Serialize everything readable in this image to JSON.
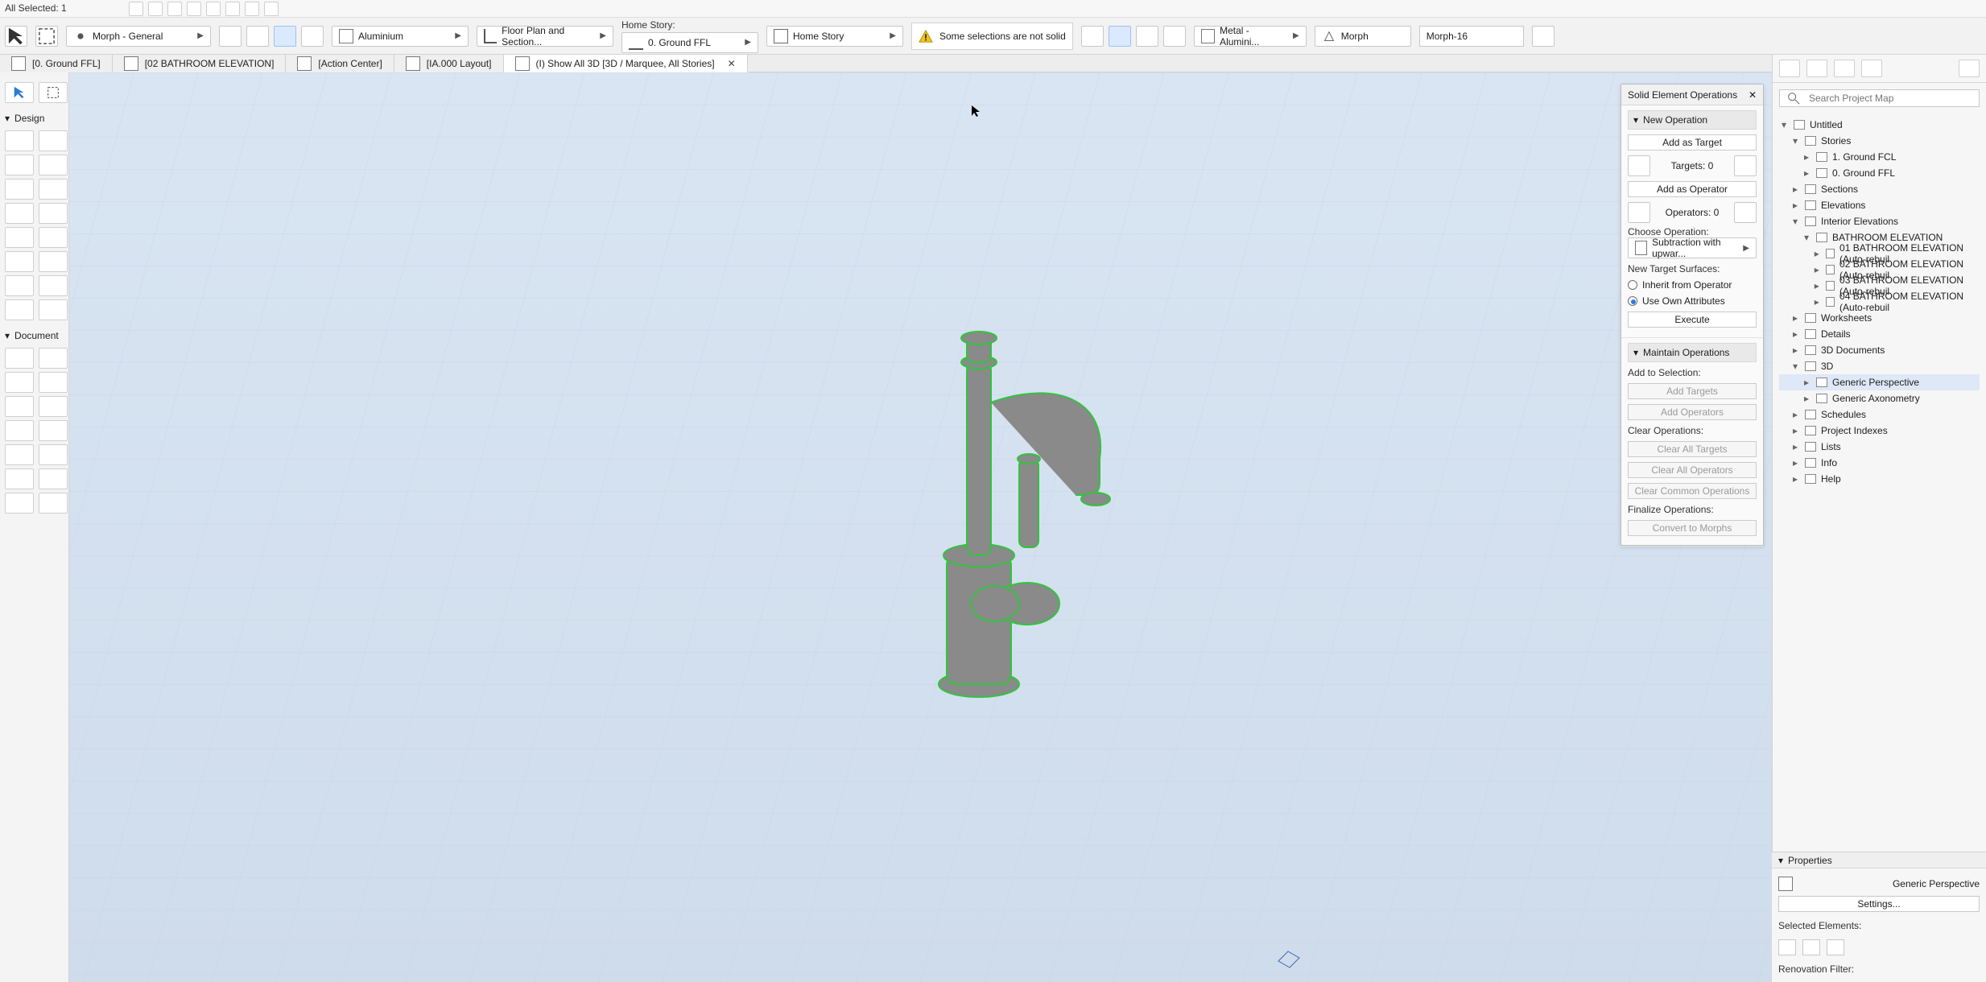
{
  "topbar": {
    "selection_info": "All Selected: 1"
  },
  "info_bar": {
    "layer_combo_label": "Morph - General",
    "material_label": "Aluminium",
    "view_combo_label": "Floor Plan and Section...",
    "home_story_label": "Home Story:",
    "home_story_value": "0. Ground FFL",
    "home_story_right": "Home Story",
    "warning_text": "Some selections are not solid",
    "surface_label": "Metal - Alumini...",
    "morph_label": "Morph",
    "id_value": "Morph-16"
  },
  "tabs": [
    {
      "label": "[0. Ground FFL]"
    },
    {
      "label": "[02 BATHROOM ELEVATION]"
    },
    {
      "label": "[Action Center]"
    },
    {
      "label": "[IA.000 Layout]"
    },
    {
      "label": "(I) Show All 3D [3D / Marquee, All Stories]"
    }
  ],
  "toolbox": {
    "design_label": "Design",
    "document_label": "Document"
  },
  "solid_ops": {
    "title": "Solid Element Operations",
    "new_operation": "New Operation",
    "add_target": "Add as Target",
    "targets_label": "Targets: 0",
    "add_operator": "Add as Operator",
    "operators_label": "Operators: 0",
    "choose_operation_label": "Choose Operation:",
    "operation_value": "Subtraction with upwar...",
    "new_target_surfaces": "New Target Surfaces:",
    "inherit_label": "Inherit from Operator",
    "use_own_label": "Use Own Attributes",
    "execute": "Execute",
    "maintain_operations": "Maintain Operations",
    "add_to_selection": "Add to Selection:",
    "add_targets": "Add Targets",
    "add_operators": "Add Operators",
    "clear_operations": "Clear Operations:",
    "clear_all_targets": "Clear All Targets",
    "clear_all_operators": "Clear All Operators",
    "clear_common_operations": "Clear Common Operations",
    "finalize_operations": "Finalize Operations:",
    "convert_to_morphs": "Convert to Morphs"
  },
  "navigator": {
    "search_placeholder": "Search Project Map",
    "tree": [
      {
        "label": "Untitled",
        "level": 0,
        "expanded": true
      },
      {
        "label": "Stories",
        "level": 1,
        "expanded": true
      },
      {
        "label": "1. Ground FCL",
        "level": 2
      },
      {
        "label": "0. Ground FFL",
        "level": 2
      },
      {
        "label": "Sections",
        "level": 1
      },
      {
        "label": "Elevations",
        "level": 1
      },
      {
        "label": "Interior Elevations",
        "level": 1,
        "expanded": true
      },
      {
        "label": "BATHROOM ELEVATION",
        "level": 2,
        "expanded": true
      },
      {
        "label": "01 BATHROOM ELEVATION (Auto-rebuil",
        "level": 3
      },
      {
        "label": "02 BATHROOM ELEVATION (Auto-rebuil",
        "level": 3
      },
      {
        "label": "03 BATHROOM ELEVATION (Auto-rebuil",
        "level": 3
      },
      {
        "label": "04 BATHROOM ELEVATION (Auto-rebuil",
        "level": 3
      },
      {
        "label": "Worksheets",
        "level": 1
      },
      {
        "label": "Details",
        "level": 1
      },
      {
        "label": "3D Documents",
        "level": 1
      },
      {
        "label": "3D",
        "level": 1,
        "expanded": true
      },
      {
        "label": "Generic Perspective",
        "level": 2,
        "selected": true
      },
      {
        "label": "Generic Axonometry",
        "level": 2
      },
      {
        "label": "Schedules",
        "level": 1
      },
      {
        "label": "Project Indexes",
        "level": 1
      },
      {
        "label": "Lists",
        "level": 1
      },
      {
        "label": "Info",
        "level": 1
      },
      {
        "label": "Help",
        "level": 1
      }
    ]
  },
  "properties": {
    "header": "Properties",
    "view_name": "Generic Perspective",
    "settings_btn": "Settings...",
    "selected_elements": "Selected Elements:",
    "renovation_filter": "Renovation Filter:"
  }
}
